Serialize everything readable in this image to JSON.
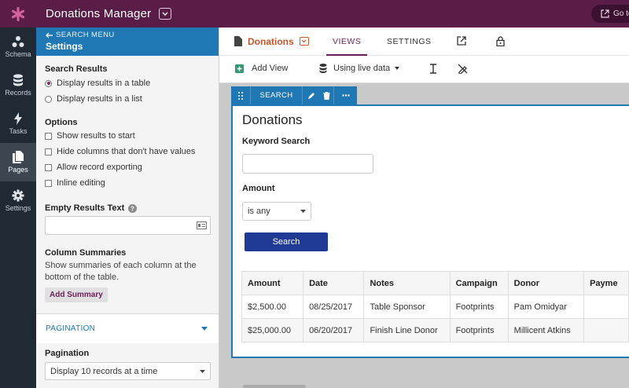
{
  "app": {
    "title": "Donations Manager",
    "goto_label": "Go to",
    "logo_icon": "asterisk-icon",
    "brand_color": "#5a1d48"
  },
  "rail": {
    "items": [
      {
        "label": "Schema",
        "icon": "schema-icon"
      },
      {
        "label": "Records",
        "icon": "database-icon"
      },
      {
        "label": "Tasks",
        "icon": "bolt-icon"
      },
      {
        "label": "Pages",
        "icon": "pages-icon",
        "active": true
      },
      {
        "label": "Settings",
        "icon": "gear-icon"
      }
    ]
  },
  "panel": {
    "back_label": "SEARCH MENU",
    "title": "Settings",
    "search_results": {
      "heading": "Search Results",
      "options": [
        "Display results in a table",
        "Display results in a list"
      ],
      "selected": 0
    },
    "options": {
      "heading": "Options",
      "items": [
        "Show results to start",
        "Hide columns that don't have values",
        "Allow record exporting",
        "Inline editing"
      ]
    },
    "empty_text": {
      "heading": "Empty Results Text",
      "value": ""
    },
    "column_summaries": {
      "heading": "Column Summaries",
      "description": "Show summaries of each column at the bottom of the table.",
      "button": "Add Summary"
    },
    "pagination": {
      "section_label": "PAGINATION",
      "label": "Pagination",
      "select_value": "Display 10 records at a time"
    }
  },
  "tabs": {
    "page_name": "Donations",
    "views": "VIEWS",
    "settings": "SETTINGS"
  },
  "toolbar": {
    "add_view": "Add View",
    "live_data": "Using live data"
  },
  "search_view": {
    "bar_label": "SEARCH",
    "title": "Donations",
    "keyword_label": "Keyword Search",
    "keyword_value": "",
    "amount_label": "Amount",
    "amount_select": "is any",
    "search_button": "Search",
    "columns": [
      "Amount",
      "Date",
      "Notes",
      "Campaign",
      "Donor",
      "Payme"
    ],
    "rows": [
      [
        "$2,500.00",
        "08/25/2017",
        "Table Sponsor",
        "Footprints",
        "Pam Omidyar",
        ""
      ],
      [
        "$25,000.00",
        "06/20/2017",
        "Finish Line Donor",
        "Footprints",
        "Millicent Atkins",
        ""
      ]
    ]
  },
  "colors": {
    "accent_blue": "#1f78b4",
    "tab_active": "#6a1f58",
    "page_tab": "#c0562b",
    "button": "#1f3a93"
  }
}
